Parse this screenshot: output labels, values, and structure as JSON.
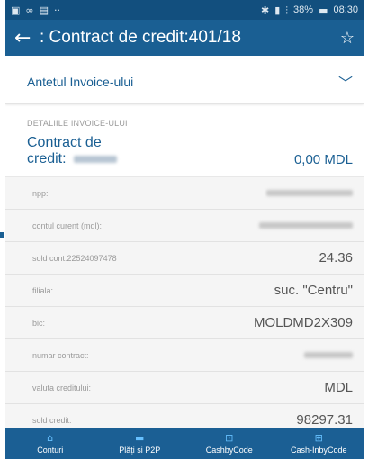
{
  "status_bar": {
    "battery_percent": "38%",
    "time": "08:30",
    "left_icons": [
      "image-icon",
      "link-icon",
      "gallery-icon",
      "more-icon"
    ],
    "right_icons": [
      "bluetooth-icon",
      "vibrate-icon",
      "signal-icon",
      "battery-icon"
    ]
  },
  "app_bar": {
    "back_icon": "arrow-left-icon",
    "title": ": Contract de credit:401/18",
    "star_icon": "star-outline-icon"
  },
  "header_section": {
    "label": "Antetul Invoice-ului",
    "chevron_icon": "chevron-down-icon"
  },
  "details_caption": "DETALIILE INVOICE-ULUI",
  "summary": {
    "name_line1": "Contract de",
    "name_line2": "credit:",
    "amount": "0,00 MDL"
  },
  "details": [
    {
      "key": "npp:",
      "value": ""
    },
    {
      "key": "contul curent (mdl):",
      "value": ""
    },
    {
      "key": "sold cont:22524097478",
      "value": "24.36"
    },
    {
      "key": "filiala:",
      "value": "suc. \"Centru\""
    },
    {
      "key": "bic:",
      "value": "MOLDMD2X309"
    },
    {
      "key": "numar contract:",
      "value": ""
    },
    {
      "key": "valuta creditului:",
      "value": "MDL"
    },
    {
      "key": "sold credit:",
      "value": "98297.31"
    }
  ],
  "bottom_nav": [
    {
      "label": "Conturi",
      "icon": "home-icon"
    },
    {
      "label": "Plăți și P2P",
      "icon": "wallet-icon"
    },
    {
      "label": "CashbyCode",
      "icon": "cash-code-icon"
    },
    {
      "label": "Cash-InbyCode",
      "icon": "cash-in-code-icon"
    }
  ],
  "colors": {
    "app_bar": "#1a5f93",
    "status_bar": "#124f7e",
    "accent_text": "#1a5f93",
    "bottom_nav": "#1b5f94"
  }
}
